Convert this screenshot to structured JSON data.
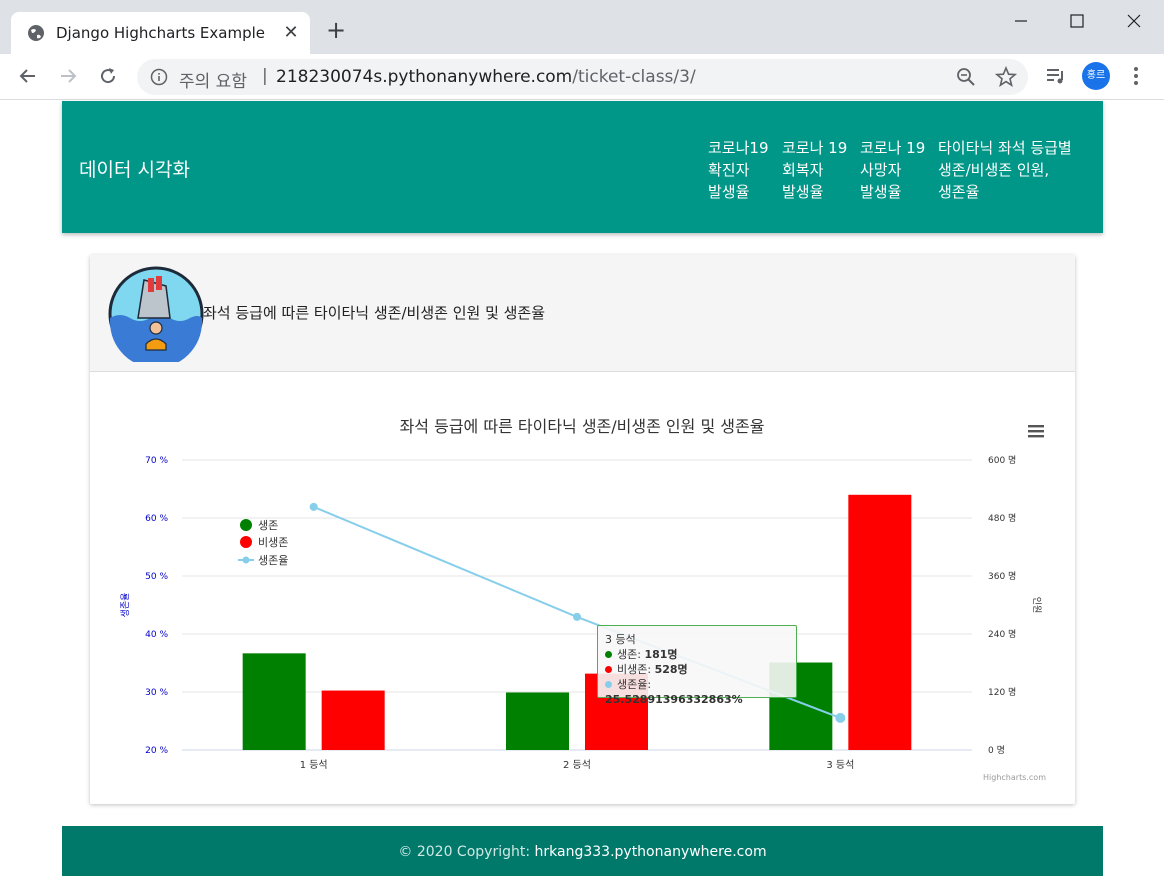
{
  "browser": {
    "tab_title": "Django Highcharts Example",
    "omnibox_warning": "주의 요함",
    "omnibox_separator": "|",
    "url_host": "218230074s.pythonanywhere.com",
    "url_path": "/ticket-class/3/",
    "profile_initials": "홍르"
  },
  "navbar": {
    "brand": "데이터 시각화",
    "links": [
      "코로나19\n확진자\n발생율",
      "코로나 19\n회복자\n발생율",
      "코로나 19\n사망자\n발생율",
      "타이타닉 좌석 등급별\n생존/비생존 인원,\n생존율"
    ]
  },
  "card": {
    "heading": "좌석 등급에 따른 타이타닉 생존/비생존 인원 및 생존율"
  },
  "chart_data": {
    "type": "bar",
    "title": "좌석 등급에 따른 타이타닉 생존/비생존 인원 및 생존율",
    "categories": [
      "1 등석",
      "2 등석",
      "3 등석"
    ],
    "series": [
      {
        "name": "생존",
        "type": "bar",
        "axis": "right",
        "values": [
          200,
          119,
          181
        ],
        "color": "#008000"
      },
      {
        "name": "비생존",
        "type": "bar",
        "axis": "right",
        "values": [
          123,
          158,
          528
        ],
        "color": "#ff0000"
      },
      {
        "name": "생존율",
        "type": "line",
        "axis": "left",
        "values": [
          61.92,
          42.95,
          25.52891396332863
        ],
        "color": "#87ceeb"
      }
    ],
    "y_left": {
      "label": "생존율",
      "ylim": [
        20,
        70
      ],
      "ticks": [
        "20 %",
        "30 %",
        "40 %",
        "50 %",
        "60 %",
        "70 %"
      ]
    },
    "y_right": {
      "label": "인원",
      "ylim": [
        0,
        600
      ],
      "ticks": [
        "0 명",
        "120 명",
        "240 명",
        "360 명",
        "480 명",
        "600 명"
      ]
    },
    "legend": "top-left",
    "grid": true,
    "credits": "Highcharts.com",
    "tooltip": {
      "title": "3 등석",
      "rows": [
        {
          "label": "생존: ",
          "value": "181명",
          "color": "#008000"
        },
        {
          "label": "비생존: ",
          "value": "528명",
          "color": "#ff0000"
        },
        {
          "label": "생존율: ",
          "value": "25.52891396332863%",
          "color": "#87ceeb"
        }
      ]
    }
  },
  "footer": {
    "copyright": "© 2020 Copyright: ",
    "link": "hrkang333.pythonanywhere.com"
  }
}
